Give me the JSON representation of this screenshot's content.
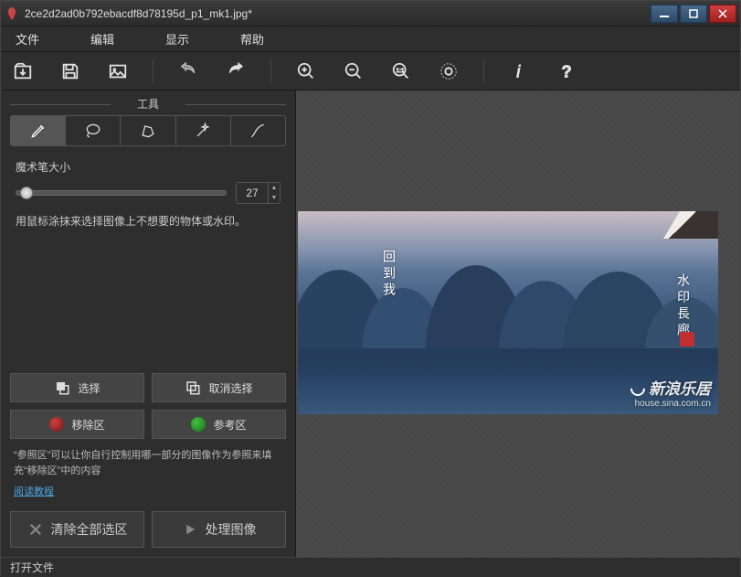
{
  "window": {
    "title": "2ce2d2ad0b792ebacdf8d78195d_p1_mk1.jpg*"
  },
  "menu": {
    "file": "文件",
    "edit": "编辑",
    "view": "显示",
    "help": "帮助"
  },
  "tools_panel": {
    "title": "工具",
    "brush_size_label": "魔术笔大小",
    "brush_size_value": "27",
    "hint": "用鼠标涂抹来选择图像上不想要的物体或水印。"
  },
  "buttons": {
    "select": "选择",
    "deselect": "取消选择",
    "remove_zone": "移除区",
    "ref_zone": "参考区",
    "clear_all": "清除全部选区",
    "process": "处理图像"
  },
  "help": {
    "text": "“参照区”可以让你自行控制用哪一部分的图像作为参照来填充“移除区”中的内容",
    "link": "阅读教程"
  },
  "image_overlay": {
    "text1": "回到我",
    "text2": "水印長廊",
    "watermark_brand": "新浪乐居",
    "watermark_url": "house.sina.com.cn"
  },
  "statusbar": {
    "text": "打开文件"
  }
}
